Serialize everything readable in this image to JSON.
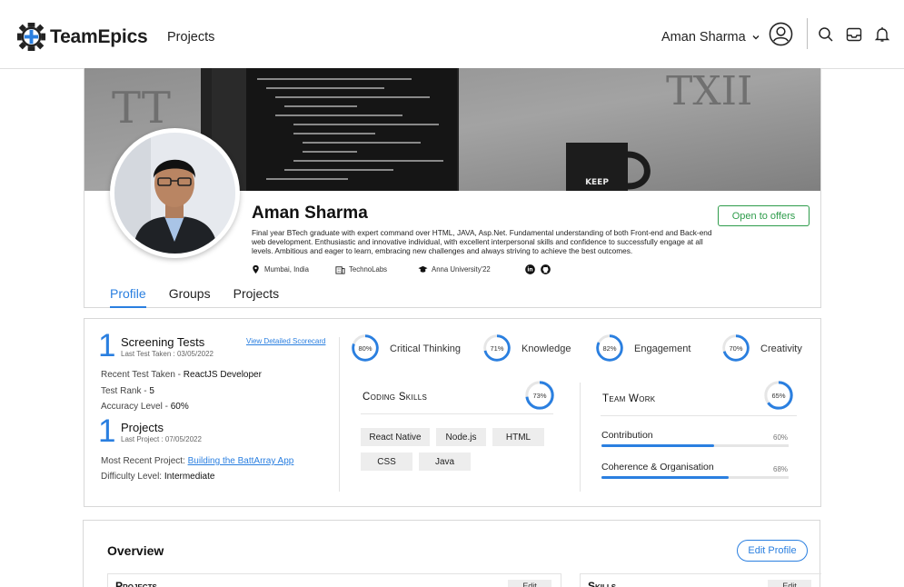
{
  "header": {
    "brand": "TeamEpics",
    "nav_projects": "Projects",
    "user_name": "Aman Sharma"
  },
  "profile": {
    "name": "Aman Sharma",
    "bio": "Final year BTech graduate with expert command over HTML, JAVA, Asp.Net. Fundamental understanding of both Front-end and Back-end web development. Enthusiastic and innovative individual, with excellent interpersonal skills and confidence to successfully engage at all levels. Ambitious and eager to learn, embracing new challenges and always striving to achieve the best outcomes.",
    "status_button": "Open to offers",
    "location": "Mumbai, India",
    "company": "TechnoLabs",
    "education": "Anna University'22",
    "tabs": [
      "Profile",
      "Groups",
      "Projects"
    ]
  },
  "stats": {
    "tests_count": "1",
    "tests_title": "Screening Tests",
    "tests_last": "Last Test Taken : 03/05/2022",
    "scorecard_link": "View Detailed Scorecard",
    "recent_test_label": "Recent Test Taken - ",
    "recent_test_value": "ReactJS Developer",
    "test_rank_label": "Test Rank - ",
    "test_rank_value": "5",
    "accuracy_label": "Accuracy Level - ",
    "accuracy_value": "60%",
    "projects_count": "1",
    "projects_title": "Projects",
    "projects_last": "Last Project : 07/05/2022",
    "recent_project_label": "Most Recent Project: ",
    "recent_project_value": "Building the BattArray App",
    "difficulty_label": "Difficulty Level: ",
    "difficulty_value": "Intermediate",
    "rings": [
      {
        "label": "Critical Thinking",
        "pct_text": "80%",
        "value": 0.8
      },
      {
        "label": "Knowledge",
        "pct_text": "71%",
        "value": 0.71
      },
      {
        "label": "Engagement",
        "pct_text": "82%",
        "value": 0.82
      },
      {
        "label": "Creativity",
        "pct_text": "70%",
        "value": 0.7
      }
    ],
    "coding": {
      "title": "Coding Skills",
      "pct_text": "73%",
      "value": 0.73,
      "skills": [
        "React Native",
        "Node.js",
        "HTML",
        "CSS",
        "Java"
      ]
    },
    "teamwork": {
      "title": "Team Work",
      "pct_text": "65%",
      "value": 0.65,
      "bars": [
        {
          "label": "Contribution",
          "pct_text": "60%",
          "value": 0.6
        },
        {
          "label": "Coherence & Organisation",
          "pct_text": "68%",
          "value": 0.68
        }
      ]
    }
  },
  "overview": {
    "title": "Overview",
    "edit_profile": "Edit Profile",
    "projects_title": "Projects",
    "skills_title": "Skills",
    "edit_label": "Edit"
  },
  "colors": {
    "accent": "#2a7fe0",
    "green": "#2e9c4b"
  }
}
